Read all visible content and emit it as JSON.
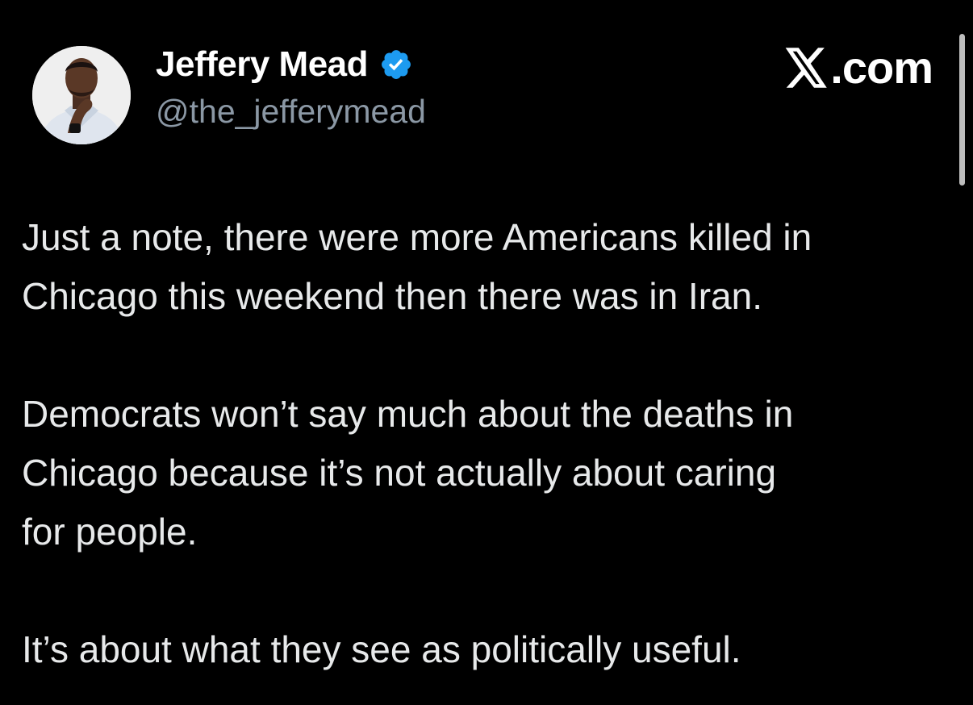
{
  "author": {
    "display_name": "Jeffery Mead",
    "handle": "@the_jefferymead",
    "avatar_icon": "profile-photo-icon",
    "verified_icon": "verified-badge-icon",
    "verified_color": "#1d9bf0"
  },
  "brand": {
    "logo_icon": "x-logo-icon",
    "suffix": ".com"
  },
  "tweet": {
    "paragraphs": [
      {
        "lines": [
          "Just a note, there were more Americans killed in",
          "Chicago this weekend then there was in Iran."
        ]
      },
      {
        "lines": [
          "Democrats won’t say much about the deaths in",
          "Chicago because it’s not actually about caring",
          "for people."
        ]
      },
      {
        "lines": [
          "It’s about what they see as politically useful."
        ]
      }
    ]
  },
  "colors": {
    "background": "#000000",
    "text": "#e7e9ea",
    "secondary_text": "#8b98a5",
    "accent": "#1d9bf0"
  }
}
